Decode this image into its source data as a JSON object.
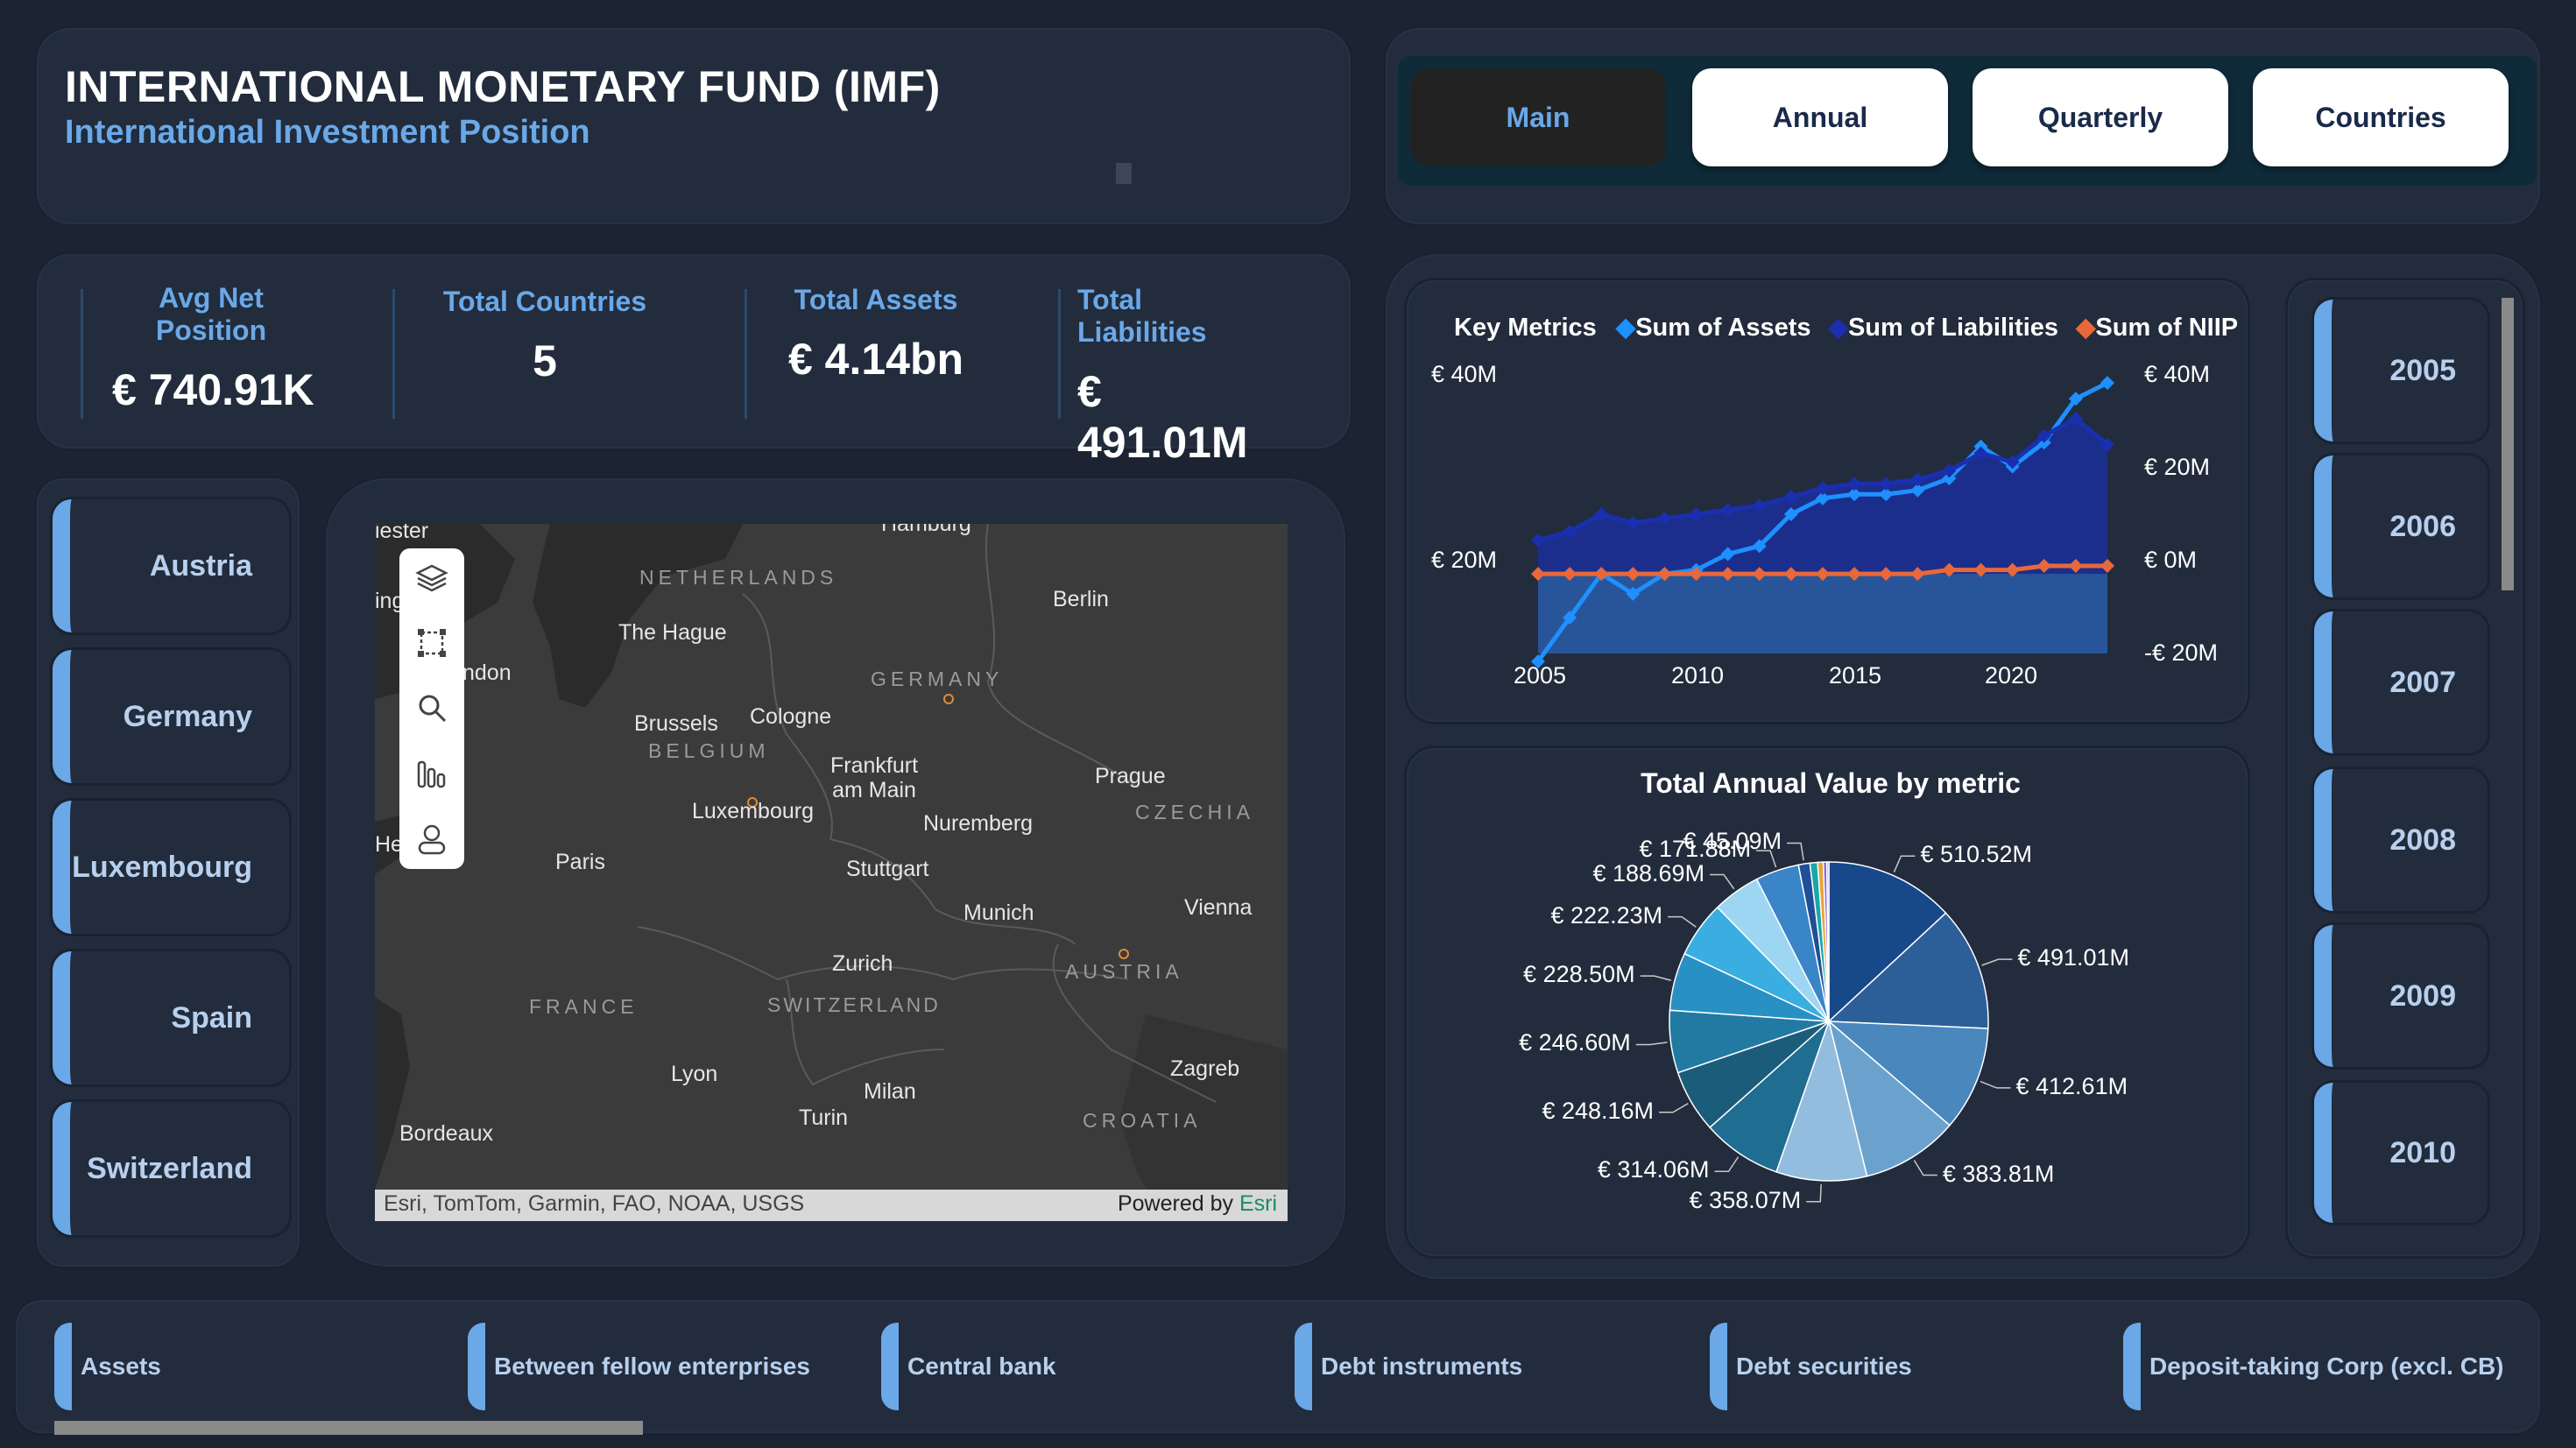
{
  "header": {
    "title": "INTERNATIONAL MONETARY FUND (IMF)",
    "subtitle": "International Investment Position"
  },
  "nav": {
    "buttons": [
      {
        "label": "Main",
        "active": true
      },
      {
        "label": "Annual",
        "active": false
      },
      {
        "label": "Quarterly",
        "active": false
      },
      {
        "label": "Countries",
        "active": false
      }
    ]
  },
  "kpis": [
    {
      "label": "Avg Net Position",
      "value": "€ 740.91K"
    },
    {
      "label": "Total Countries",
      "value": "5"
    },
    {
      "label": "Total Assets",
      "value": "€ 4.14bn"
    },
    {
      "label": "Total Liabilities",
      "value": "€ 491.01M"
    }
  ],
  "countries": [
    "Austria",
    "Germany",
    "Luxembourg",
    "Spain",
    "Switzerland"
  ],
  "map": {
    "cities": [
      "Hamburg",
      "Berlin",
      "The Hague",
      "Brussels",
      "Cologne",
      "Frankfurt am Main",
      "Luxembourg",
      "Prague",
      "Nuremberg",
      "Paris",
      "Stuttgart",
      "Munich",
      "Vienna",
      "Zurich",
      "Lyon",
      "Milan",
      "Zagreb",
      "Turin",
      "Bordeaux"
    ],
    "countries": [
      "NETHERLANDS",
      "GERMANY",
      "BELGIUM",
      "CZECHIA",
      "AUSTRIA",
      "SWITZERLAND",
      "FRANCE",
      "CROATIA"
    ],
    "edge_fragments": [
      "iester",
      "ing",
      "ndon",
      "He"
    ],
    "attribution": "Esri, TomTom, Garmin, FAO, NOAA, USGS",
    "powered_by": "Powered by",
    "powered_by_brand": "Esri",
    "tools": [
      "layers-icon",
      "select-region-icon",
      "search-icon",
      "chart-icon",
      "person-icon"
    ]
  },
  "line_chart": {
    "legend_title": "Key Metrics",
    "left_ticks": [
      "€ 40M",
      "€ 20M"
    ],
    "right_ticks": [
      "€ 40M",
      "€ 20M",
      "€ 0M",
      "-€ 20M"
    ],
    "x_ticks": [
      "2005",
      "2010",
      "2015",
      "2020"
    ]
  },
  "chart_data": [
    {
      "type": "line",
      "title": "Key Metrics",
      "x": [
        2005,
        2006,
        2007,
        2008,
        2009,
        2010,
        2011,
        2012,
        2013,
        2014,
        2015,
        2016,
        2017,
        2018,
        2019,
        2020,
        2021,
        2022,
        2023
      ],
      "series": [
        {
          "name": "Sum of Assets",
          "axis": "right",
          "color": "#1e90ff",
          "values": [
            -22,
            -11,
            0,
            -5,
            0,
            1,
            5,
            7,
            15,
            19,
            20,
            20,
            21,
            24,
            32,
            27,
            33,
            44,
            48
          ]
        },
        {
          "name": "Sum of Liabilities",
          "axis": "left",
          "color": "#1a2fb0",
          "values": [
            26,
            27,
            29,
            28,
            28.5,
            29,
            29.5,
            30,
            31,
            32,
            32.5,
            32.5,
            33,
            34,
            36,
            35,
            38,
            40,
            37
          ]
        },
        {
          "name": "Sum of NIIP",
          "axis": "right",
          "color": "#e8683a",
          "values": [
            0,
            0,
            0,
            0,
            0,
            0,
            0,
            0,
            0,
            0,
            0,
            0,
            0,
            1,
            1,
            1,
            2,
            2,
            2
          ]
        }
      ],
      "ylim_left": [
        13,
        45
      ],
      "ylim_right": [
        -20,
        50
      ],
      "legend_placement": "top"
    },
    {
      "type": "pie",
      "title": "Total Annual Value by metric",
      "labels": [
        "€ 510.52M",
        "€ 491.01M",
        "€ 412.61M",
        "€ 383.81M",
        "€ 358.07M",
        "€ 314.06M",
        "€ 248.16M",
        "€ 246.60M",
        "€ 228.50M",
        "€ 222.23M",
        "€ 188.69M",
        "€ 171.88M",
        "€ 45.09M"
      ],
      "values": [
        510.52,
        491.01,
        412.61,
        383.81,
        358.07,
        314.06,
        248.16,
        246.6,
        228.5,
        222.23,
        188.69,
        171.88,
        45.09,
        30,
        22,
        14,
        8
      ],
      "colors": [
        "#17488a",
        "#2c5f98",
        "#4a87bc",
        "#6aa2cd",
        "#93bddf",
        "#1f6d91",
        "#1b5c7a",
        "#227aa3",
        "#2990c4",
        "#3aaee0",
        "#9dd6f2",
        "#3a84c8",
        "#1f4f96",
        "#1aa7a7",
        "#e8a33a",
        "#8c6adf",
        "#b98fd8"
      ]
    }
  ],
  "years": [
    "2005",
    "2006",
    "2007",
    "2008",
    "2009",
    "2010"
  ],
  "bottom_slicer": [
    "Assets",
    "Between fellow enterprises",
    "Central bank",
    "Debt instruments",
    "Debt securities",
    "Deposit-taking Corp (excl. CB)"
  ]
}
